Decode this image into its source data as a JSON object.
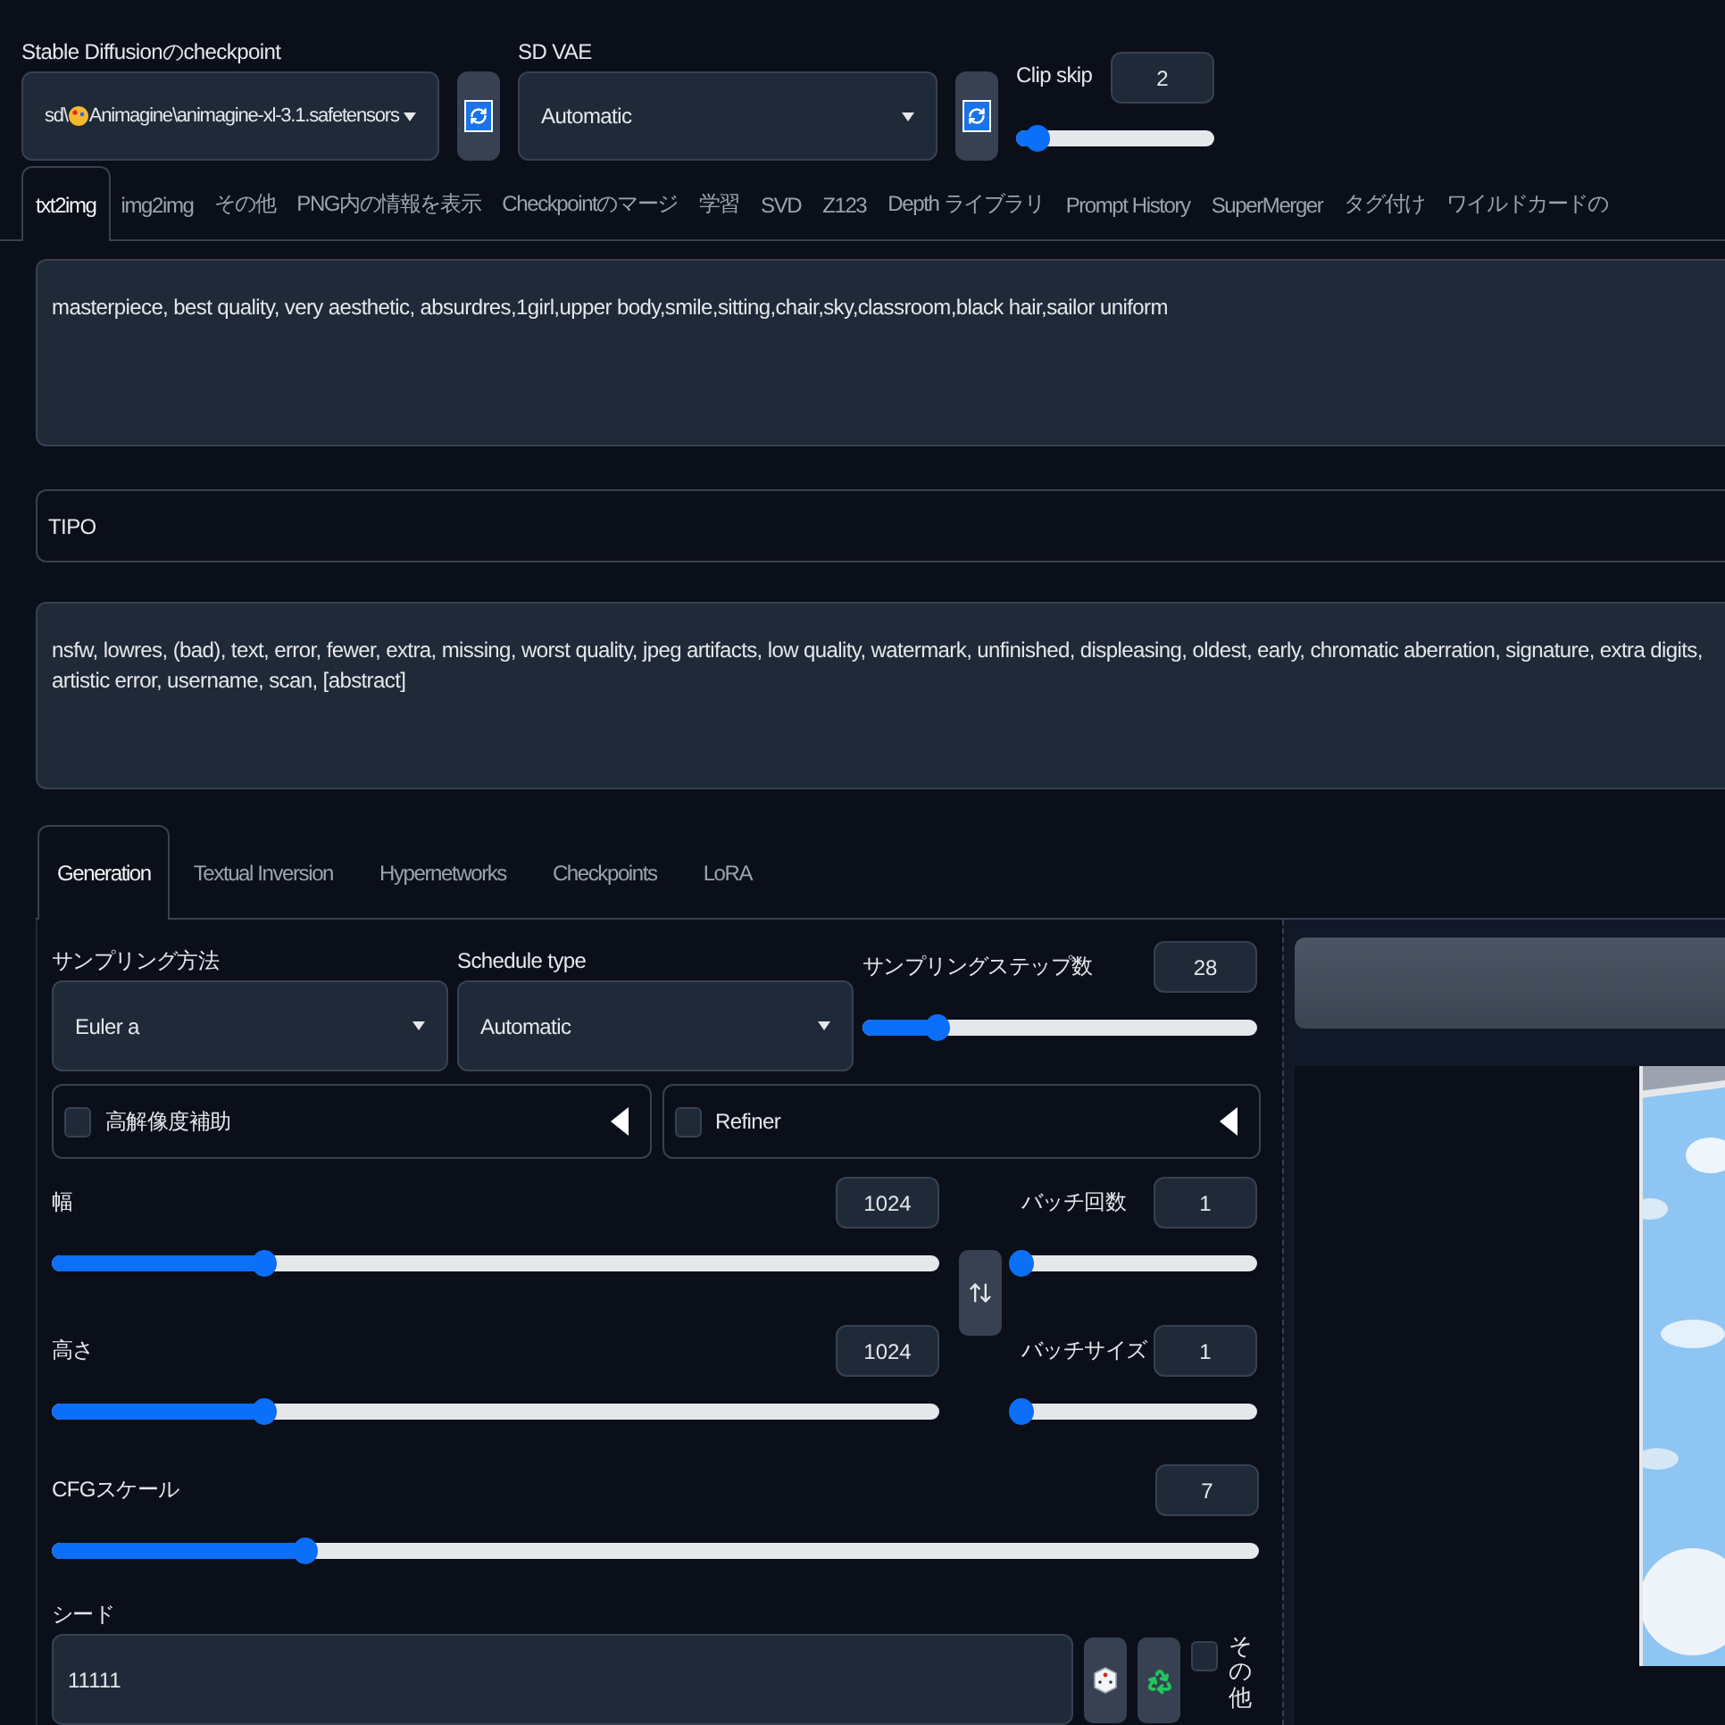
{
  "checkpoint": {
    "label": "Stable Diffusionのcheckpoint",
    "folder": "sd\\",
    "name": "Animagine\\animagine-xl-3.1.safetensors"
  },
  "vae": {
    "label": "SD VAE",
    "value": "Automatic"
  },
  "clip_skip": {
    "label": "Clip skip",
    "value": "2",
    "level": 0.11
  },
  "tabs": [
    {
      "label": "txt2img",
      "selected": true
    },
    {
      "label": "img2img",
      "selected": false
    },
    {
      "label": "その他",
      "selected": false
    },
    {
      "label": "PNG内の情報を表示",
      "selected": false
    },
    {
      "label": "Checkpointのマージ",
      "selected": false
    },
    {
      "label": "学習",
      "selected": false
    },
    {
      "label": "SVD",
      "selected": false
    },
    {
      "label": "Z123",
      "selected": false
    },
    {
      "label": "Depth ライブラリ",
      "selected": false
    },
    {
      "label": "Prompt History",
      "selected": false
    },
    {
      "label": "SuperMerger",
      "selected": false
    },
    {
      "label": "タグ付け",
      "selected": false
    },
    {
      "label": "ワイルドカードの",
      "selected": false
    }
  ],
  "prompt": "masterpiece, best quality, very aesthetic, absurdres,1girl,upper body,smile,sitting,chair,sky,classroom,black hair,sailor uniform",
  "tipo": {
    "label": "TIPO"
  },
  "negative_prompt": "nsfw, lowres, (bad), text, error, fewer, extra, missing, worst quality, jpeg artifacts, low quality, watermark, unfinished, displeasing, oldest, early, chromatic aberration, signature, extra digits, artistic error, username, scan, [abstract]",
  "generation_tabs": [
    {
      "label": "Generation",
      "selected": true
    },
    {
      "label": "Textual Inversion",
      "selected": false
    },
    {
      "label": "Hypernetworks",
      "selected": false
    },
    {
      "label": "Checkpoints",
      "selected": false
    },
    {
      "label": "LoRA",
      "selected": false
    }
  ],
  "sampler": {
    "label": "サンプリング方法",
    "value": "Euler a"
  },
  "schedule": {
    "label": "Schedule type",
    "value": "Automatic"
  },
  "steps": {
    "label": "サンプリングステップ数",
    "value": "28",
    "level": 0.19
  },
  "accordions": [
    {
      "label": "高解像度補助",
      "checked": false,
      "expanded": false
    },
    {
      "label": "Refiner",
      "checked": false,
      "expanded": false
    }
  ],
  "width": {
    "label": "幅",
    "value": "1024",
    "level": 0.24
  },
  "height": {
    "label": "高さ",
    "value": "1024",
    "level": 0.24
  },
  "batch_count": {
    "label": "バッチ回数",
    "value": "1",
    "level": 0
  },
  "batch_size": {
    "label": "バッチサイズ",
    "value": "1",
    "level": 0
  },
  "cfg": {
    "label": "CFGスケール",
    "value": "7",
    "level": 0.21
  },
  "seed": {
    "label": "シード",
    "value": "11111"
  },
  "extra": {
    "label": "その他",
    "checked": false
  }
}
